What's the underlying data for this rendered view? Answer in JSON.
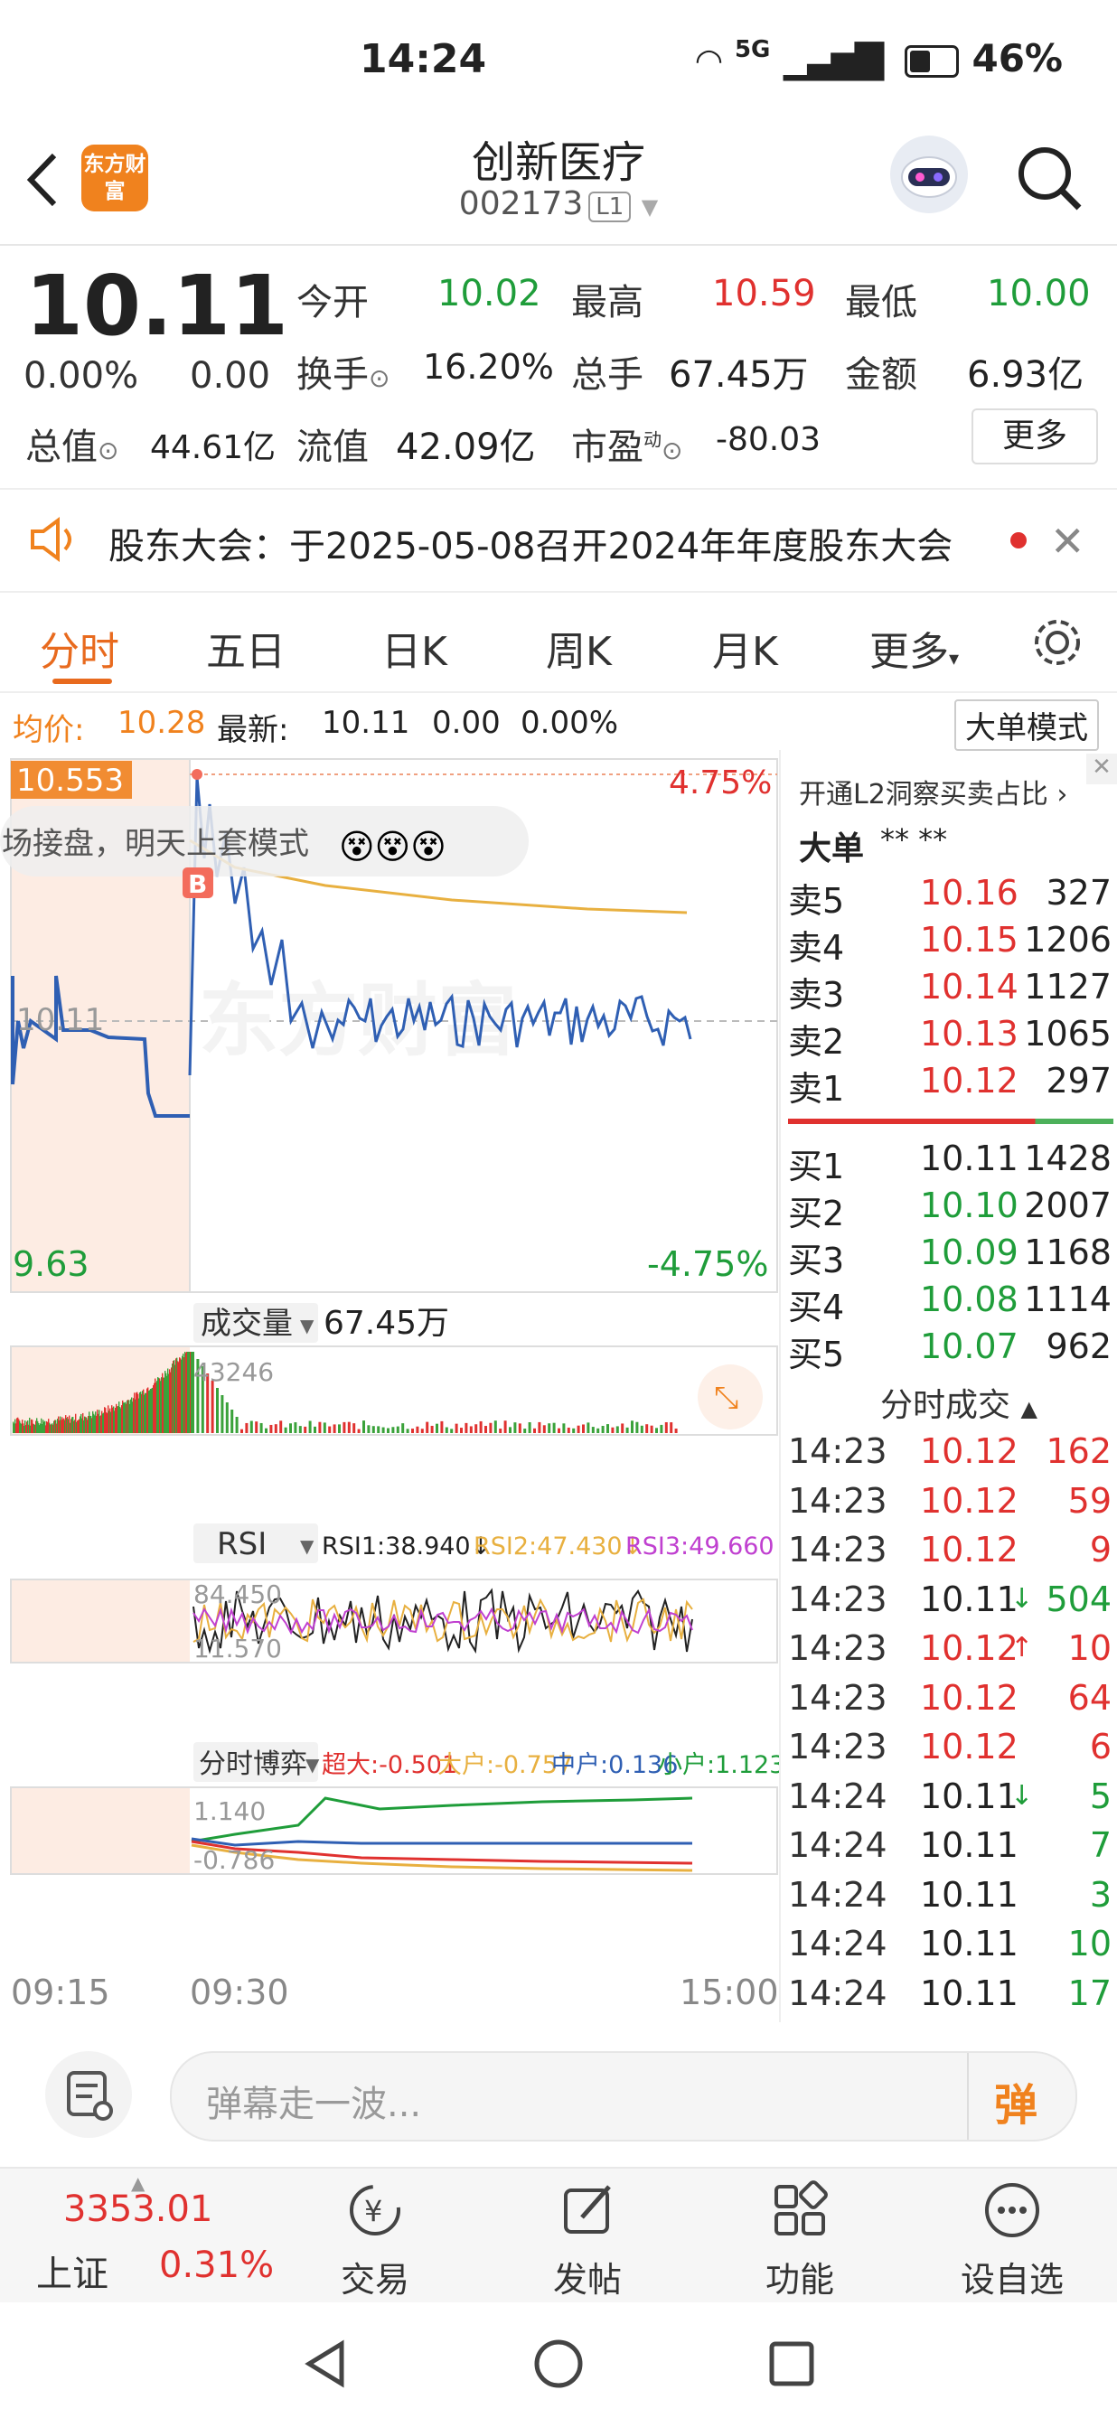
{
  "status": {
    "time": "14:24",
    "network": "5G",
    "battery": "46%"
  },
  "header": {
    "name": "创新医疗",
    "code": "002173",
    "level": "L1",
    "logo_text": "东方财富"
  },
  "quote": {
    "price": "10.11",
    "pct": "0.00%",
    "change": "0.00",
    "open_label": "今开",
    "open": "10.02",
    "high_label": "最高",
    "high": "10.59",
    "low_label": "最低",
    "low": "10.00",
    "turnover_label": "换手",
    "turnover": "16.20%",
    "volume_label": "总手",
    "volume": "67.45万",
    "amount_label": "金额",
    "amount": "6.93亿",
    "mktcap_label": "总值",
    "mktcap": "44.61亿",
    "float_label": "流值",
    "float": "42.09亿",
    "pe_label": "市盈",
    "pe_sup": "动",
    "pe": "-80.03",
    "more": "更多"
  },
  "notice": {
    "text": "股东大会：于2025-05-08召开2024年年度股东大会"
  },
  "tabs": [
    "分时",
    "五日",
    "日K",
    "周K",
    "月K",
    "更多"
  ],
  "avg": {
    "label": "均价:",
    "value": "10.28",
    "latest_label": "最新:",
    "latest": "10.11",
    "chg": "0.00",
    "pct": "0.00%",
    "mode": "大单模式"
  },
  "chart": {
    "price_top": "10.553",
    "pct_top": "4.75%",
    "price_mid": "10.11",
    "price_bottom": "9.63",
    "pct_bottom": "-4.75%",
    "banner": "场接盘，明天上套模式",
    "b_marker": "B",
    "watermark": "东方财富",
    "vol_label": "成交量",
    "vol_value": "67.45万",
    "vol_max": "43246",
    "rsi_label": "RSI",
    "rsi1": "RSI1:38.940↓",
    "rsi2": "RSI2:47.430↓",
    "rsi3": "RSI3:49.660↓",
    "rsi_top": "84.450",
    "rsi_bottom": "11.570",
    "game_label": "分时博弈",
    "super": "超大:-0.501",
    "big": "大户:-0.757",
    "mid": "中户:0.136",
    "small": "小户:1.123",
    "game_top": "1.140",
    "game_bottom": "-0.786",
    "t_start": "09:15",
    "t_open": "09:30",
    "t_end": "15:00"
  },
  "orderbook": {
    "promo": "开通L2洞察买卖占比",
    "big_label": "大单",
    "big_vals": "**  **",
    "asks": [
      {
        "label": "卖5",
        "price": "10.16",
        "vol": "327"
      },
      {
        "label": "卖4",
        "price": "10.15",
        "vol": "1206"
      },
      {
        "label": "卖3",
        "price": "10.14",
        "vol": "1127"
      },
      {
        "label": "卖2",
        "price": "10.13",
        "vol": "1065"
      },
      {
        "label": "卖1",
        "price": "10.12",
        "vol": "297"
      }
    ],
    "bids": [
      {
        "label": "买1",
        "price": "10.11",
        "vol": "1428"
      },
      {
        "label": "买2",
        "price": "10.10",
        "vol": "2007"
      },
      {
        "label": "买3",
        "price": "10.09",
        "vol": "1168"
      },
      {
        "label": "买4",
        "price": "10.08",
        "vol": "1114"
      },
      {
        "label": "买5",
        "price": "10.07",
        "vol": "962"
      }
    ],
    "trades_label": "分时成交",
    "trades": [
      {
        "t": "14:23",
        "p": "10.12",
        "v": "162",
        "pc": "red",
        "vc": "red",
        "arrow": ""
      },
      {
        "t": "14:23",
        "p": "10.12",
        "v": "59",
        "pc": "red",
        "vc": "red",
        "arrow": ""
      },
      {
        "t": "14:23",
        "p": "10.12",
        "v": "9",
        "pc": "red",
        "vc": "red",
        "arrow": ""
      },
      {
        "t": "14:23",
        "p": "10.11",
        "v": "504",
        "pc": "dark",
        "vc": "green",
        "arrow": "↓"
      },
      {
        "t": "14:23",
        "p": "10.12",
        "v": "10",
        "pc": "red",
        "vc": "red",
        "arrow": "↑"
      },
      {
        "t": "14:23",
        "p": "10.12",
        "v": "64",
        "pc": "red",
        "vc": "red",
        "arrow": ""
      },
      {
        "t": "14:23",
        "p": "10.12",
        "v": "6",
        "pc": "red",
        "vc": "red",
        "arrow": ""
      },
      {
        "t": "14:24",
        "p": "10.11",
        "v": "5",
        "pc": "dark",
        "vc": "green",
        "arrow": "↓"
      },
      {
        "t": "14:24",
        "p": "10.11",
        "v": "7",
        "pc": "dark",
        "vc": "green",
        "arrow": ""
      },
      {
        "t": "14:24",
        "p": "10.11",
        "v": "3",
        "pc": "dark",
        "vc": "green",
        "arrow": ""
      },
      {
        "t": "14:24",
        "p": "10.11",
        "v": "10",
        "pc": "dark",
        "vc": "green",
        "arrow": ""
      },
      {
        "t": "14:24",
        "p": "10.11",
        "v": "17",
        "pc": "dark",
        "vc": "green",
        "arrow": ""
      }
    ]
  },
  "comment": {
    "placeholder": "弹幕走一波...",
    "danmu": "弹"
  },
  "bottom_nav": {
    "index_value": "3353.01",
    "index_name": "上证",
    "index_pct": "0.31%",
    "items": [
      "交易",
      "发帖",
      "功能",
      "设自选"
    ]
  },
  "colors": {
    "up": "#e0312f",
    "down": "#1f9d3a",
    "accent": "#f0821e",
    "price_line": "#2f5fb3",
    "avg_line": "#e8b040"
  }
}
